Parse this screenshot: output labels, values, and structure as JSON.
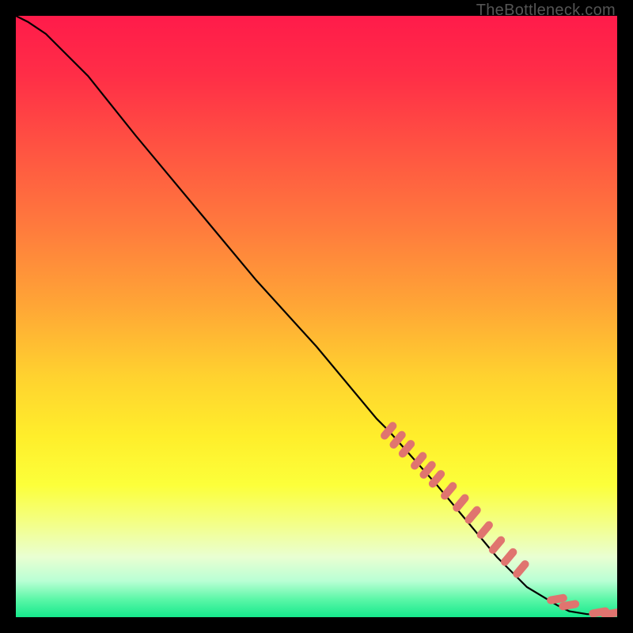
{
  "chart_data": {
    "type": "line",
    "title": "",
    "xlabel": "",
    "ylabel": "",
    "xlim": [
      0,
      100
    ],
    "ylim": [
      0,
      100
    ],
    "watermark": "TheBottleneck.com",
    "background_gradient": {
      "stops": [
        {
          "offset": 0.0,
          "color": "#ff1b4a"
        },
        {
          "offset": 0.1,
          "color": "#ff2e47"
        },
        {
          "offset": 0.22,
          "color": "#ff5342"
        },
        {
          "offset": 0.35,
          "color": "#ff7a3d"
        },
        {
          "offset": 0.48,
          "color": "#ffa536"
        },
        {
          "offset": 0.6,
          "color": "#ffd22f"
        },
        {
          "offset": 0.7,
          "color": "#ffee2b"
        },
        {
          "offset": 0.78,
          "color": "#fcff3a"
        },
        {
          "offset": 0.84,
          "color": "#f4ff82"
        },
        {
          "offset": 0.9,
          "color": "#e9ffd2"
        },
        {
          "offset": 0.94,
          "color": "#b9ffd4"
        },
        {
          "offset": 0.97,
          "color": "#5cf7a8"
        },
        {
          "offset": 1.0,
          "color": "#15e98c"
        }
      ]
    },
    "series": [
      {
        "name": "bottleneck-curve",
        "type": "line",
        "color": "#000000",
        "x": [
          0,
          2,
          5,
          8,
          12,
          20,
          30,
          40,
          50,
          60,
          62,
          70,
          80,
          85,
          90,
          92,
          95,
          100
        ],
        "y": [
          100,
          99,
          97,
          94,
          90,
          80,
          68,
          56,
          45,
          33,
          31,
          22,
          10,
          5,
          2,
          1,
          0.5,
          0.5
        ]
      },
      {
        "name": "gpu-points",
        "type": "scatter",
        "color": "#e0746f",
        "marker": "pill",
        "x": [
          62,
          63.5,
          65,
          67,
          68.5,
          70,
          72,
          74,
          76,
          78,
          80,
          82,
          84,
          90,
          92,
          97,
          99
        ],
        "y": [
          31,
          29.5,
          28,
          26,
          24.5,
          23,
          21,
          19,
          17,
          14.5,
          12,
          10,
          8,
          3,
          2,
          0.8,
          0.6
        ]
      }
    ]
  }
}
